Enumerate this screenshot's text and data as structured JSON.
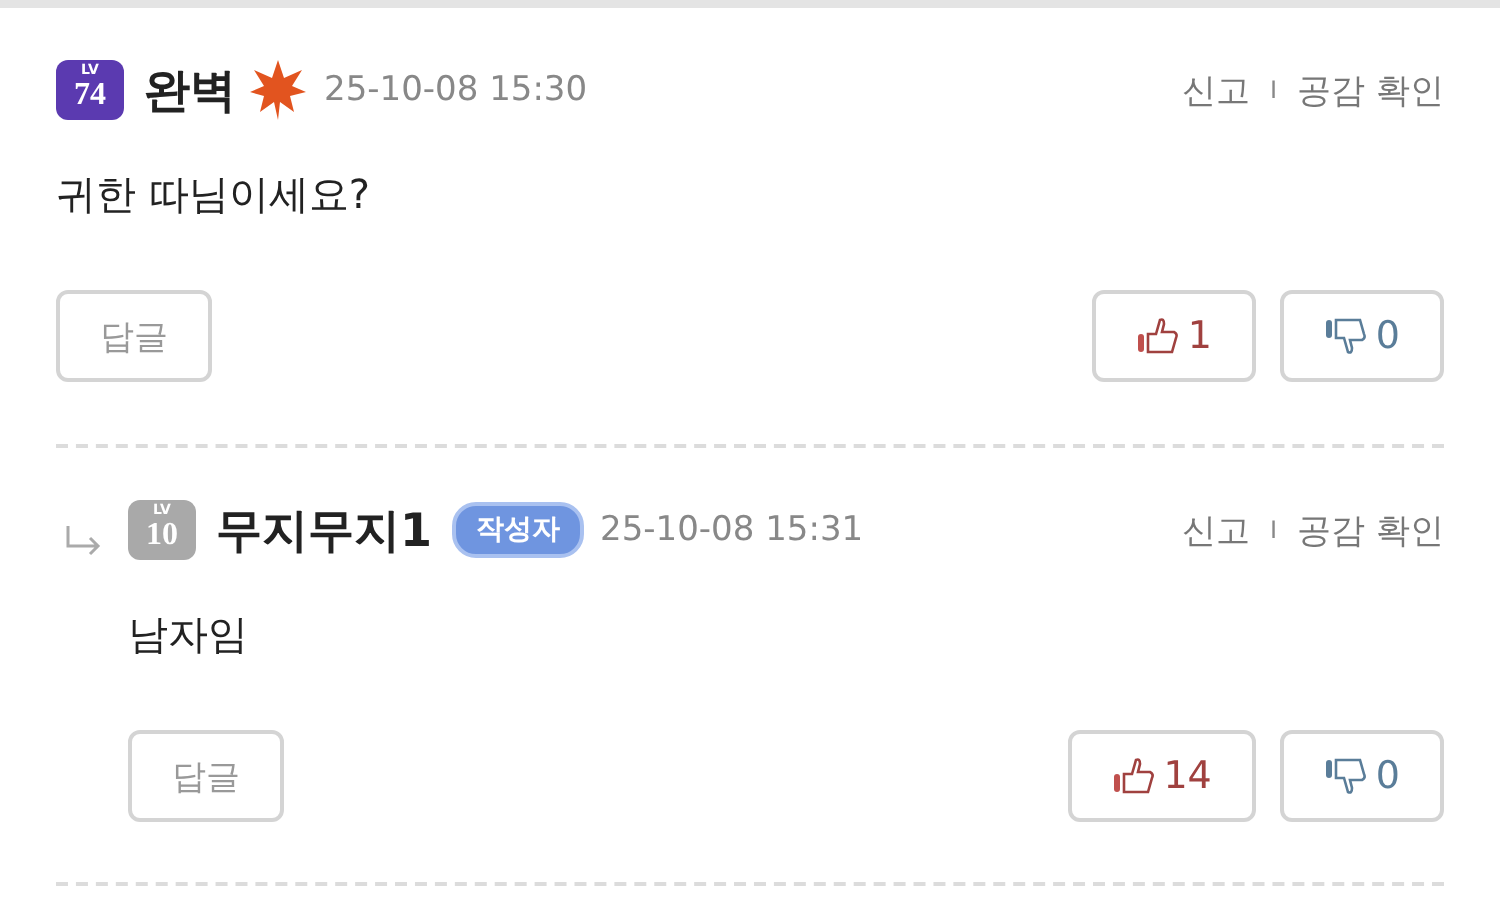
{
  "comments": [
    {
      "kind": "comment",
      "rank_label": "LV",
      "rank": "74",
      "nickname": "완벽",
      "emblem": true,
      "date": "25-10-08 15:30",
      "report": "신고",
      "separator": "I",
      "likes_check": "공감 확인",
      "body": "귀한 따님이세요?",
      "reply_button": "답글",
      "up": "1",
      "down": "0"
    },
    {
      "kind": "reply",
      "rank_label": "LV",
      "rank": "10",
      "nickname": "무지무지1",
      "emblem": false,
      "author_tag": "작성자",
      "date": "25-10-08 15:31",
      "report": "신고",
      "separator": "I",
      "likes_check": "공감 확인",
      "body": "남자임",
      "reply_button": "답글",
      "up": "14",
      "down": "0"
    }
  ]
}
